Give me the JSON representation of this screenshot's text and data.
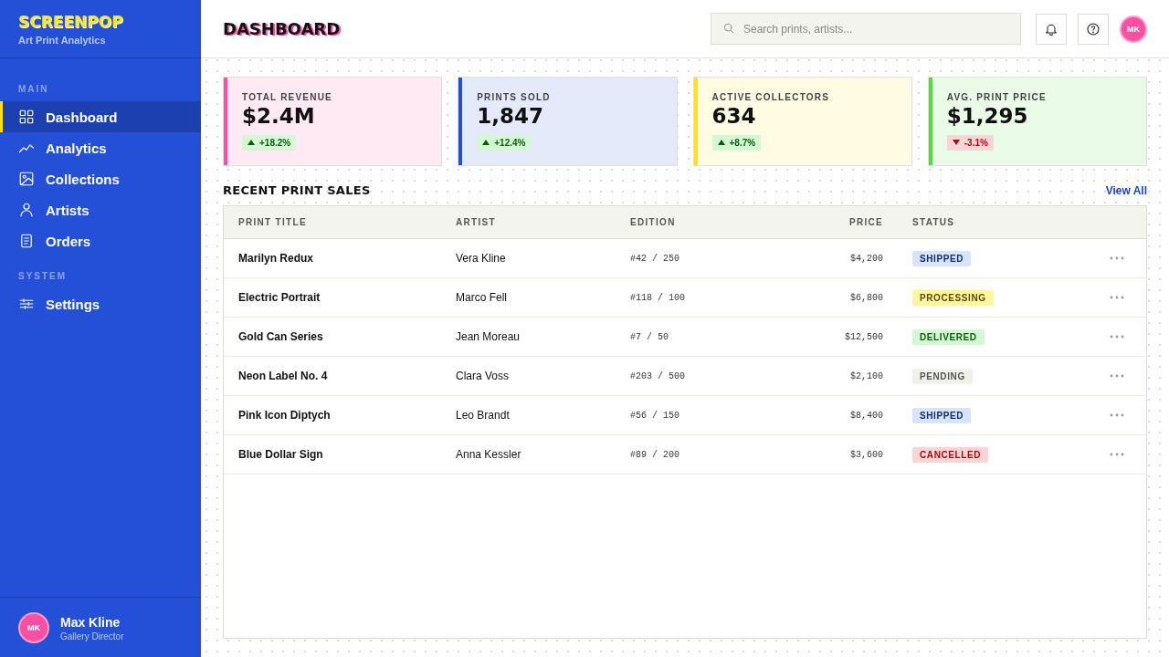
{
  "sidebar": {
    "logo": "SCREENPOP",
    "subtitle": "Art Print Analytics",
    "sections": [
      {
        "label": "MAIN",
        "items": [
          {
            "label": "Dashboard",
            "selected": true
          },
          {
            "label": "Analytics",
            "selected": false
          },
          {
            "label": "Collections",
            "selected": false
          },
          {
            "label": "Artists",
            "selected": false
          },
          {
            "label": "Orders",
            "selected": false
          }
        ]
      },
      {
        "label": "SYSTEM",
        "items": [
          {
            "label": "Settings",
            "selected": false
          }
        ]
      }
    ],
    "user": {
      "initials": "MK",
      "name": "Max Kline",
      "role": "Gallery Director"
    }
  },
  "header": {
    "title": "DASHBOARD",
    "search": {
      "placeholder": "Search prints, artists..."
    },
    "avatar": "MK"
  },
  "stats": [
    {
      "label": "TOTAL REVENUE",
      "value": "$2.4M",
      "change": "+18.2%",
      "kind": "up",
      "color": "#ff4fa3"
    },
    {
      "label": "PRINTS SOLD",
      "value": "1,847",
      "change": "+12.4%",
      "kind": "up",
      "color": "#2450d8"
    },
    {
      "label": "ACTIVE COLLECTORS",
      "value": "634",
      "change": "+8.7%",
      "kind": "up",
      "color": "#ffe01a"
    },
    {
      "label": "AVG. PRINT PRICE",
      "value": "$1,295",
      "change": "-3.1%",
      "kind": "down",
      "color": "#4ae03a"
    }
  ],
  "sales": {
    "title": "RECENT PRINT SALES",
    "link": "View All",
    "columns": [
      "PRINT TITLE",
      "ARTIST",
      "EDITION",
      "PRICE",
      "STATUS"
    ],
    "rows": [
      {
        "title": "Marilyn Redux",
        "artist": "Vera Kline",
        "edition": "#42 / 250",
        "price": "$4,200",
        "status": "SHIPPED",
        "kind": "shipped"
      },
      {
        "title": "Electric Portrait",
        "artist": "Marco Fell",
        "edition": "#118 / 100",
        "price": "$6,800",
        "status": "PROCESSING",
        "kind": "processing"
      },
      {
        "title": "Gold Can Series",
        "artist": "Jean Moreau",
        "edition": "#7 / 50",
        "price": "$12,500",
        "status": "DELIVERED",
        "kind": "delivered"
      },
      {
        "title": "Neon Label No. 4",
        "artist": "Clara Voss",
        "edition": "#203 / 500",
        "price": "$2,100",
        "status": "PENDING",
        "kind": "pending"
      },
      {
        "title": "Pink Icon Diptych",
        "artist": "Leo Brandt",
        "edition": "#56 / 150",
        "price": "$8,400",
        "status": "SHIPPED",
        "kind": "shipped"
      },
      {
        "title": "Blue Dollar Sign",
        "artist": "Anna Kessler",
        "edition": "#89 / 200",
        "price": "$3,600",
        "status": "CANCELLED",
        "kind": "cancelled"
      }
    ]
  }
}
